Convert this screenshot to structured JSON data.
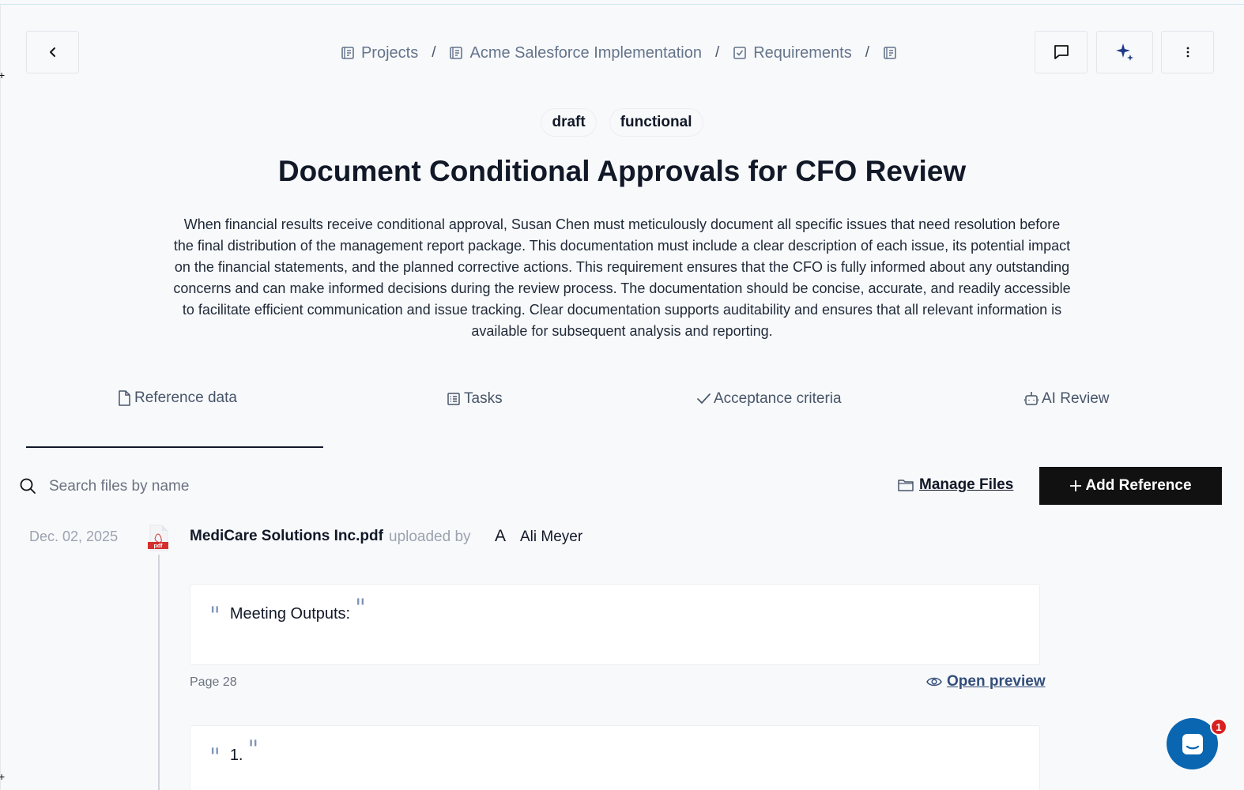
{
  "header": {
    "breadcrumb": [
      {
        "label": "Projects",
        "icon": "document-icon"
      },
      {
        "label": "Acme Salesforce Implementation",
        "icon": "document-icon"
      },
      {
        "label": "Requirements",
        "icon": "checkbox-icon"
      },
      {
        "label": "",
        "icon": "document-icon"
      }
    ],
    "separator": "/"
  },
  "requirement": {
    "tags": [
      "draft",
      "functional"
    ],
    "title": "Document Conditional Approvals for CFO Review",
    "description": "When financial results receive conditional approval, Susan Chen must meticulously document all specific issues that need resolution before the final distribution of the management report package. This documentation must include a clear description of each issue, its potential impact on the financial statements, and the planned corrective actions. This requirement ensures that the CFO is fully informed about any outstanding concerns and can make informed decisions during the review process. The documentation should be concise, accurate, and readily accessible to facilitate efficient communication and issue tracking. Clear documentation supports auditability and ensures that all relevant information is available for subsequent analysis and reporting."
  },
  "tabs": [
    {
      "label": "Reference data",
      "icon": "file-icon",
      "active": true
    },
    {
      "label": "Tasks",
      "icon": "list-icon",
      "active": false
    },
    {
      "label": "Acceptance criteria",
      "icon": "check-icon",
      "active": false
    },
    {
      "label": "AI Review",
      "icon": "robot-icon",
      "active": false
    }
  ],
  "toolbar": {
    "search_placeholder": "Search files by name",
    "manage_files_label": "Manage Files",
    "add_reference_label": "Add Reference"
  },
  "file": {
    "date": "Dec. 02, 2025",
    "name": "MediCare Solutions Inc.pdf",
    "uploaded_by_label": "uploaded by",
    "avatar_initial": "A",
    "uploader": "Ali Meyer",
    "icon_label": "pdf",
    "quotes": [
      {
        "text": "Meeting Outputs:",
        "page": "Page 28",
        "preview_label": "Open preview"
      },
      {
        "text": "1.",
        "page": "",
        "preview_label": ""
      }
    ]
  },
  "chat": {
    "badge_count": "1"
  },
  "colors": {
    "accent": "#111111",
    "chat_blue": "#0a66b0",
    "badge_red": "#d92020",
    "pdf_red": "#d32f2f"
  }
}
